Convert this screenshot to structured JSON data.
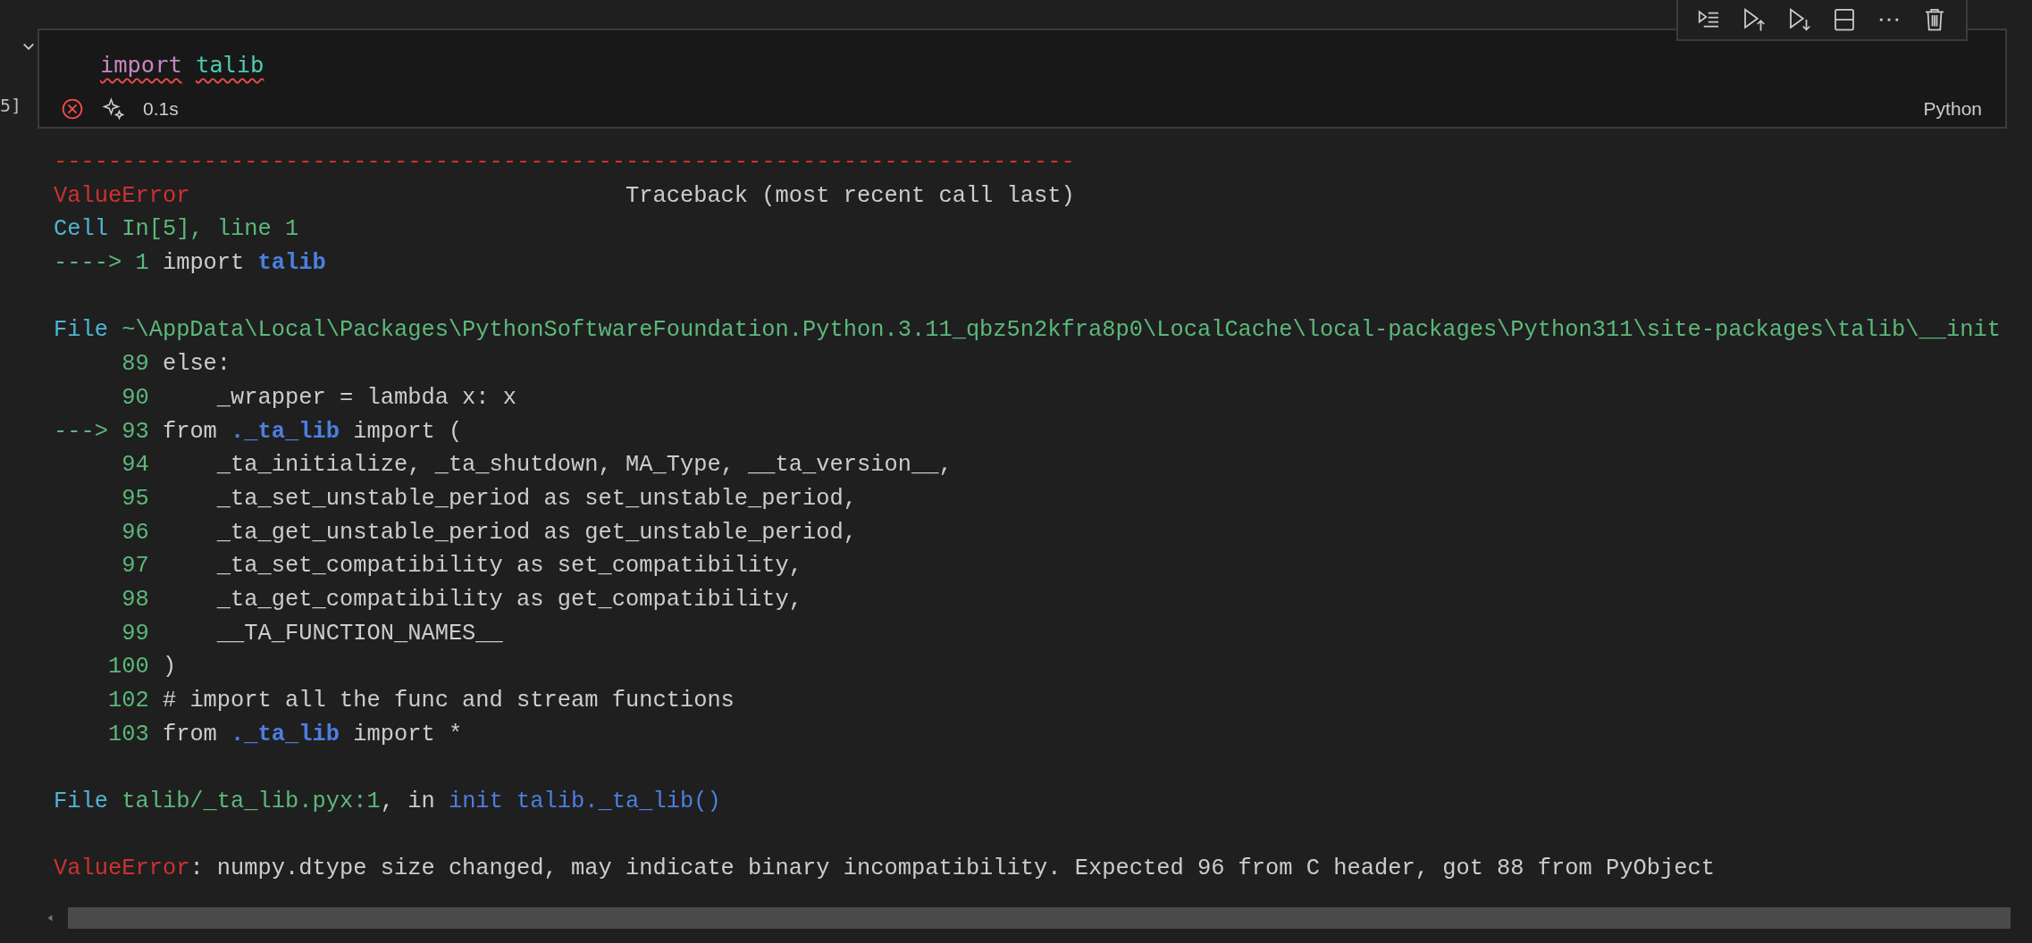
{
  "cell": {
    "execution_count": "5]",
    "code": [
      {
        "kind": "keyword",
        "text": "import",
        "space_after": true
      },
      {
        "kind": "module",
        "text": "talib"
      }
    ],
    "error_underline": true,
    "failed": true,
    "duration": "0.1s",
    "language": "Python"
  },
  "output": [
    {
      "segments": [
        {
          "kind": "red",
          "text": "---------------------------------------------------------------------------"
        }
      ]
    },
    {
      "segments": [
        {
          "kind": "red",
          "text": "ValueError"
        },
        {
          "kind": "plain",
          "text": "                                Traceback (most recent call last)"
        }
      ]
    },
    {
      "segments": [
        {
          "kind": "cyan",
          "text": "Cell"
        },
        {
          "kind": "green",
          "text": " In[5], line 1"
        }
      ]
    },
    {
      "segments": [
        {
          "kind": "green",
          "text": "----> 1"
        },
        {
          "kind": "plain",
          "text": " import "
        },
        {
          "kind": "bold",
          "text": "talib"
        }
      ]
    },
    {
      "gap_before": true,
      "segments": [
        {
          "kind": "cyan",
          "text": "File"
        },
        {
          "kind": "green",
          "text": " ~\\AppData\\Local\\Packages\\PythonSoftwareFoundation.Python.3.11_qbz5n2kfra8p0\\LocalCache\\local-packages\\Python311\\site-packages\\talib\\__init"
        }
      ]
    },
    {
      "segments": [
        {
          "kind": "green",
          "text": "     89"
        },
        {
          "kind": "plain",
          "text": " else:"
        }
      ]
    },
    {
      "segments": [
        {
          "kind": "green",
          "text": "     90"
        },
        {
          "kind": "plain",
          "text": "     _wrapper = lambda x: x"
        }
      ]
    },
    {
      "segments": [
        {
          "kind": "green",
          "text": "---> 93"
        },
        {
          "kind": "plain",
          "text": " from "
        },
        {
          "kind": "bold",
          "text": "._ta_lib"
        },
        {
          "kind": "plain",
          "text": " import ("
        }
      ]
    },
    {
      "segments": [
        {
          "kind": "green",
          "text": "     94"
        },
        {
          "kind": "plain",
          "text": "     _ta_initialize, _ta_shutdown, MA_Type, __ta_version__,"
        }
      ]
    },
    {
      "segments": [
        {
          "kind": "green",
          "text": "     95"
        },
        {
          "kind": "plain",
          "text": "     _ta_set_unstable_period as set_unstable_period,"
        }
      ]
    },
    {
      "segments": [
        {
          "kind": "green",
          "text": "     96"
        },
        {
          "kind": "plain",
          "text": "     _ta_get_unstable_period as get_unstable_period,"
        }
      ]
    },
    {
      "segments": [
        {
          "kind": "green",
          "text": "     97"
        },
        {
          "kind": "plain",
          "text": "     _ta_set_compatibility as set_compatibility,"
        }
      ]
    },
    {
      "segments": [
        {
          "kind": "green",
          "text": "     98"
        },
        {
          "kind": "plain",
          "text": "     _ta_get_compatibility as get_compatibility,"
        }
      ]
    },
    {
      "segments": [
        {
          "kind": "green",
          "text": "     99"
        },
        {
          "kind": "plain",
          "text": "     __TA_FUNCTION_NAMES__"
        }
      ]
    },
    {
      "segments": [
        {
          "kind": "green",
          "text": "    100"
        },
        {
          "kind": "plain",
          "text": " )"
        }
      ]
    },
    {
      "segments": [
        {
          "kind": "green",
          "text": "    102"
        },
        {
          "kind": "plain",
          "text": " # import all the func and stream functions"
        }
      ]
    },
    {
      "segments": [
        {
          "kind": "green",
          "text": "    103"
        },
        {
          "kind": "plain",
          "text": " from "
        },
        {
          "kind": "bold",
          "text": "._ta_lib"
        },
        {
          "kind": "plain",
          "text": " import *"
        }
      ]
    },
    {
      "gap_before": true,
      "segments": [
        {
          "kind": "cyan",
          "text": "File"
        },
        {
          "kind": "green",
          "text": " talib/_ta_lib.pyx:1"
        },
        {
          "kind": "plain",
          "text": ", in "
        },
        {
          "kind": "blue",
          "text": "init talib._ta_lib()"
        }
      ]
    },
    {
      "gap_before": true,
      "segments": [
        {
          "kind": "red",
          "text": "ValueError"
        },
        {
          "kind": "plain",
          "text": ": numpy.dtype size changed, may indicate binary incompatibility. Expected 96 from C header, got 88 from PyObject"
        }
      ]
    }
  ]
}
